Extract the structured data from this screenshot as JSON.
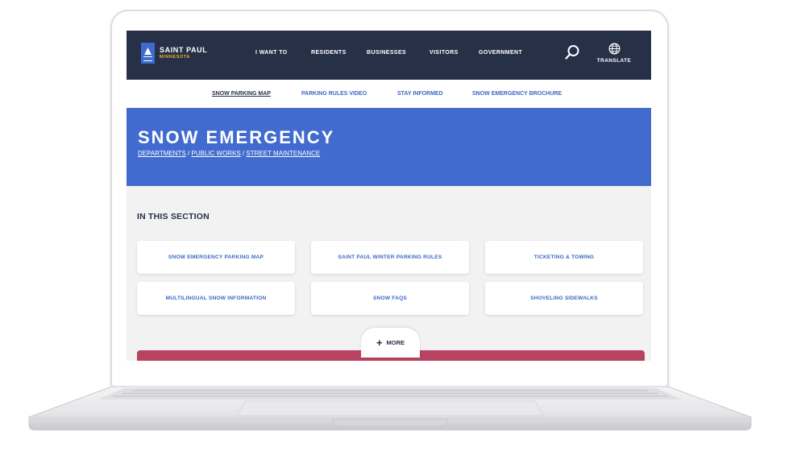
{
  "header": {
    "logo_name": "SAINT PAUL",
    "logo_sub": "MINNESOTA",
    "nav": [
      "I WANT TO",
      "RESIDENTS",
      "BUSINESSES",
      "VISITORS",
      "GOVERNMENT"
    ],
    "translate_label": "TRANSLATE"
  },
  "subnav": {
    "items": [
      "SNOW PARKING MAP",
      "PARKING RULES VIDEO",
      "STAY INFORMED",
      "SNOW EMERGENCY BROCHURE"
    ]
  },
  "hero": {
    "title": "SNOW EMERGENCY",
    "breadcrumbs": [
      "DEPARTMENTS",
      "PUBLIC WORKS",
      "STREET MAINTENANCE"
    ],
    "separator": " / "
  },
  "section": {
    "title": "IN THIS SECTION",
    "cards": [
      "SNOW EMERGENCY PARKING MAP",
      "SAINT PAUL WINTER PARKING RULES",
      "TICKETING & TOWING",
      "MULTILINGUAL SNOW INFORMATION",
      "SNOW FAQS",
      "SHOVELING SIDEWALKS"
    ],
    "more_label": "MORE",
    "more_symbol": "+"
  },
  "colors": {
    "header_bg": "#263047",
    "accent_blue": "#416bce",
    "link_blue": "#3c67c6",
    "logo_gold": "#f0b420",
    "alert_red": "#b84260"
  }
}
